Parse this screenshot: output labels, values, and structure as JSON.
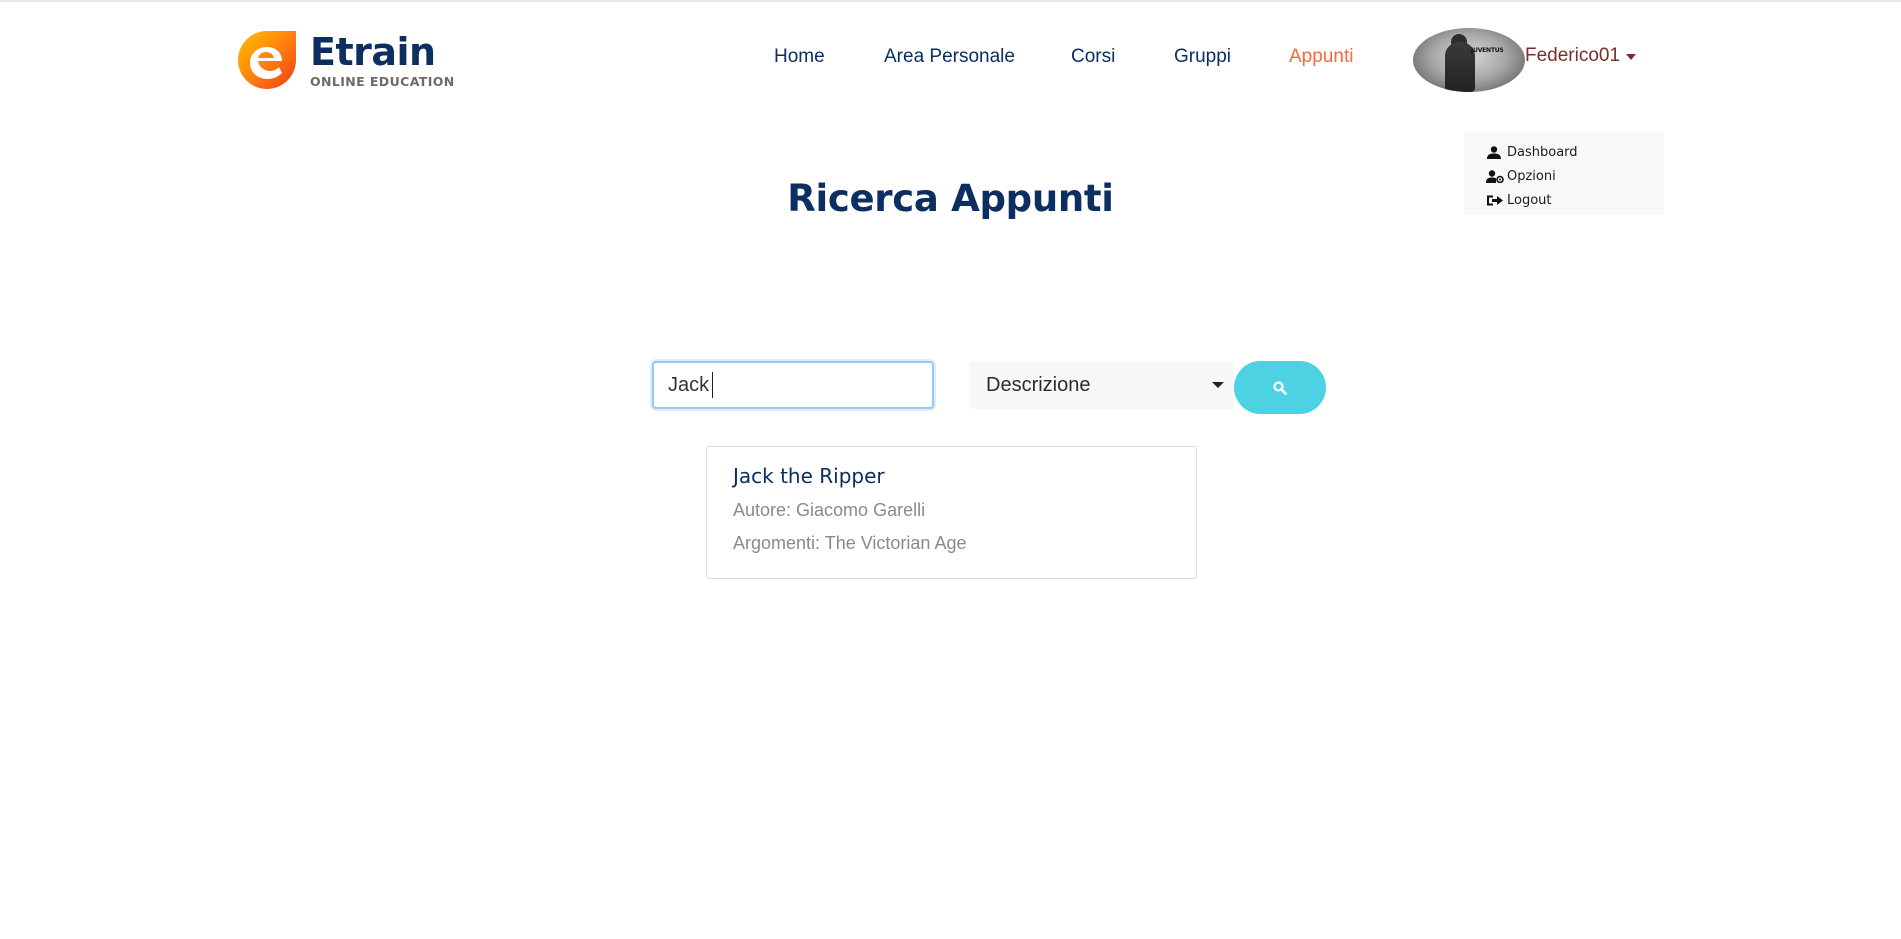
{
  "brand": {
    "name": "Etrain",
    "tagline": "ONLINE EDUCATION",
    "primary_color": "#0c2e60",
    "accent_color": "#ff663b",
    "logo_gradient": [
      "#ffb400",
      "#ff4a1c"
    ]
  },
  "nav": {
    "items": [
      {
        "label": "Home",
        "active": false
      },
      {
        "label": "Area Personale",
        "active": false
      },
      {
        "label": "Corsi",
        "active": false
      },
      {
        "label": "Gruppi",
        "active": false
      },
      {
        "label": "Appunti",
        "active": true
      }
    ],
    "user": {
      "username": "Federico01",
      "avatar_icon": "avatar-photo",
      "avatar_badge_text": "JUVENTUS"
    }
  },
  "user_menu": {
    "items": [
      {
        "label": "Dashboard",
        "icon": "user-icon"
      },
      {
        "label": "Opzioni",
        "icon": "user-gear-icon"
      },
      {
        "label": "Logout",
        "icon": "sign-out-icon"
      }
    ]
  },
  "page": {
    "title": "Ricerca Appunti"
  },
  "search": {
    "query": "Jack",
    "placeholder": "",
    "filter_selected": "Descrizione",
    "button_icon": "search-icon",
    "button_color": "#4dd2e3"
  },
  "results": [
    {
      "title": "Jack the Ripper",
      "author": "Autore: Giacomo Garelli",
      "topics": "Argomenti: The Victorian Age"
    }
  ]
}
